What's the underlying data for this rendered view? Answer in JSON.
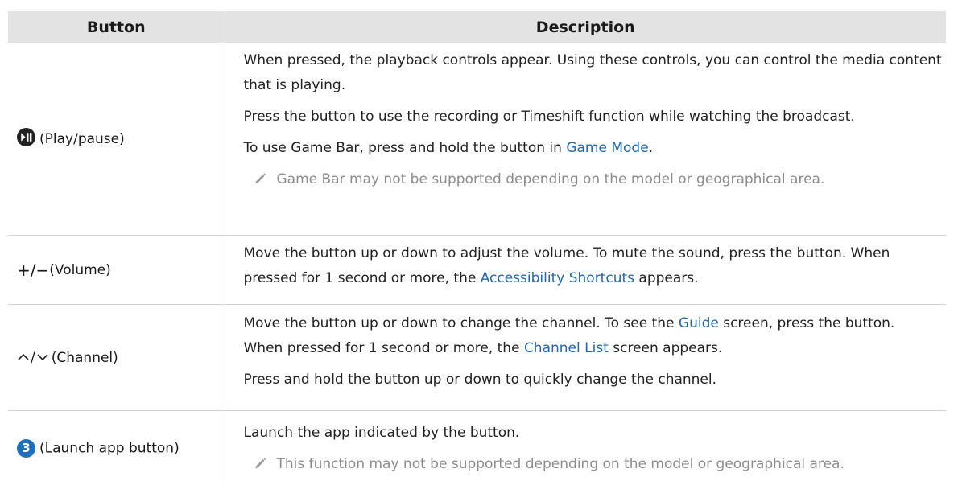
{
  "table": {
    "headers": {
      "button": "Button",
      "description": "Description"
    },
    "rows": [
      {
        "button_label": "(Play/pause)",
        "icon": "play-pause-icon",
        "paragraphs": [
          {
            "text": "When pressed, the playback controls appear. Using these controls, you can control the media content that is playing."
          },
          {
            "text": "Press the button to use the recording or Timeshift function while watching the broadcast."
          },
          {
            "pre": "To use Game Bar, press and hold the button in ",
            "link": "Game Mode",
            "post": "."
          }
        ],
        "note": "Game Bar may not be supported depending on the model or geographical area."
      },
      {
        "button_symbol_plus": "+",
        "button_symbol_sep": "/",
        "button_symbol_minus": "−",
        "button_label": "(Volume)",
        "paragraphs": [
          {
            "pre": "Move the button up or down to adjust the volume. To mute the sound, press the button. When pressed for 1 second or more, the ",
            "link": "Accessibility Shortcuts",
            "post": " appears."
          }
        ]
      },
      {
        "button_symbol_sep": "/",
        "button_label": "(Channel)",
        "paragraphs": [
          {
            "pre": "Move the button up or down to change the channel. To see the ",
            "link": "Guide",
            "post": " screen, press the button."
          },
          {
            "pre": "When pressed for 1 second or more, the ",
            "link": "Channel List",
            "post": " screen appears."
          },
          {
            "text": "Press and hold the button up or down to quickly change the channel."
          }
        ]
      },
      {
        "button_badge": "3",
        "button_label": "(Launch app button)",
        "paragraphs": [
          {
            "text": "Launch the app indicated by the button."
          }
        ],
        "note": "This function may not be supported depending on the model or geographical area."
      }
    ]
  },
  "colors": {
    "header_bg": "#e3e3e3",
    "link": "#1f67b1",
    "note_text": "#8c8c8c",
    "badge": "#1d6fc0"
  }
}
